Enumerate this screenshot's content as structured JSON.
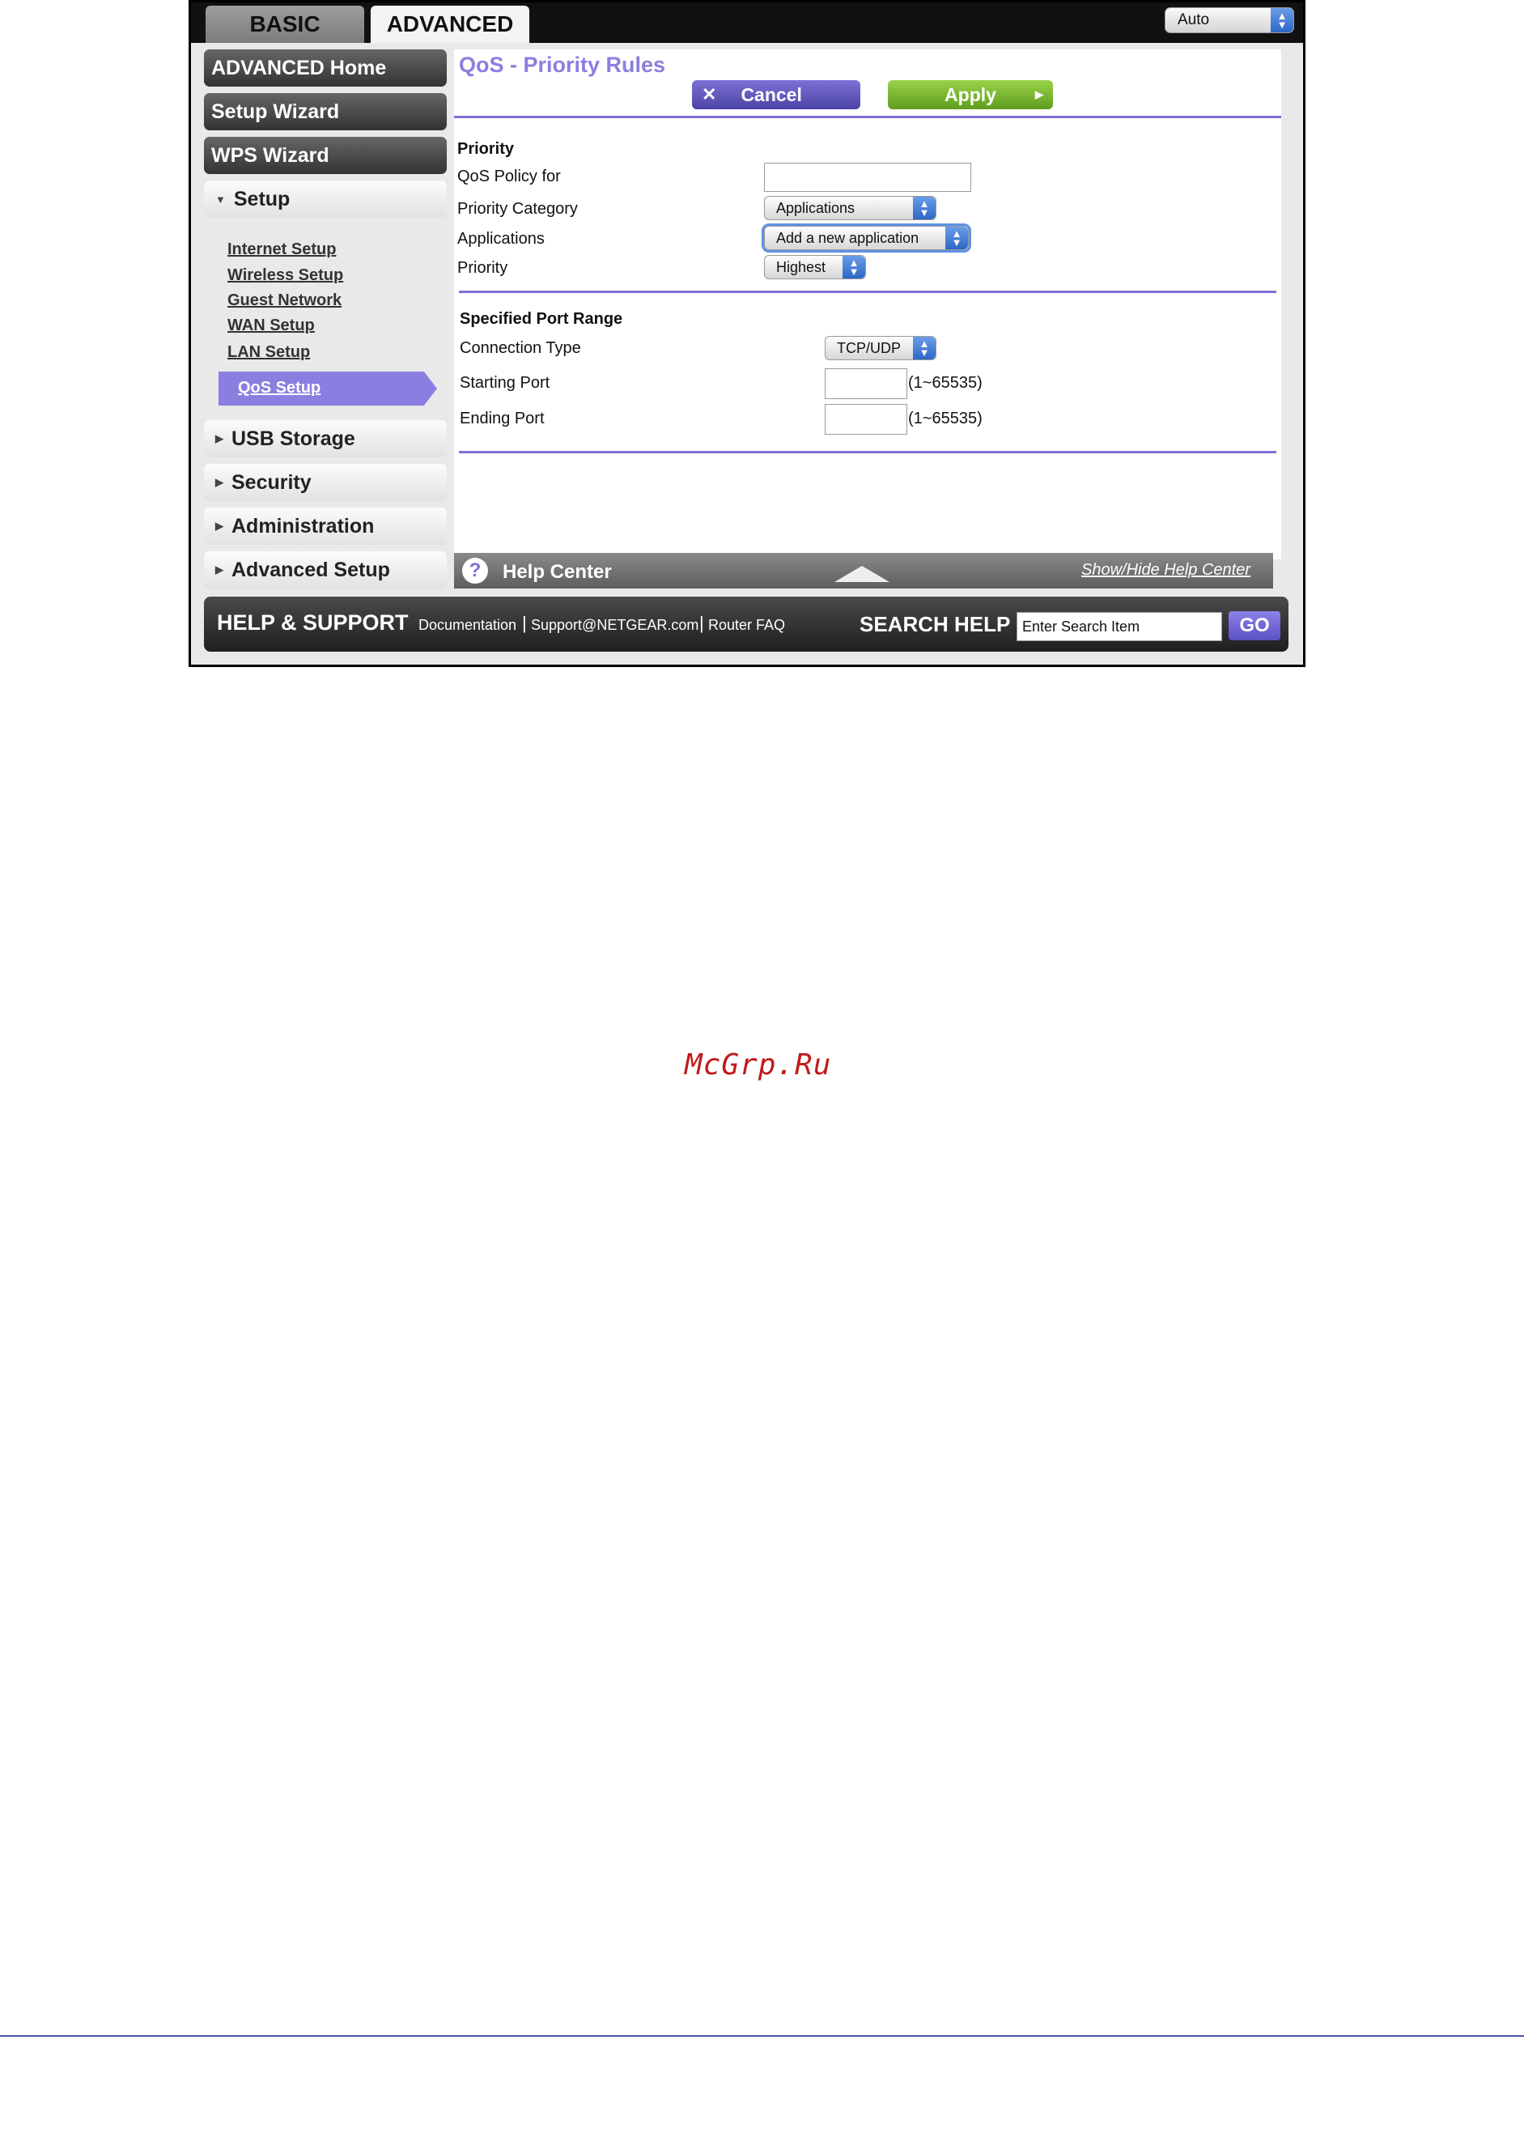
{
  "tabs": {
    "basic": "BASIC",
    "advanced": "ADVANCED"
  },
  "language_select": {
    "value": "Auto"
  },
  "sidebar": {
    "advanced_home": "ADVANCED Home",
    "setup_wizard": "Setup Wizard",
    "wps_wizard": "WPS Wizard",
    "setup": "Setup",
    "setup_items": [
      "Internet Setup",
      "Wireless Setup",
      "Guest Network",
      "WAN Setup",
      "LAN Setup",
      "QoS Setup"
    ],
    "usb_storage": "USB Storage",
    "security": "Security",
    "administration": "Administration",
    "advanced_setup": "Advanced Setup"
  },
  "page": {
    "title": "QoS - Priority Rules",
    "cancel": "Cancel",
    "apply": "Apply",
    "priority_section": "Priority",
    "qos_policy_for": "QoS Policy for",
    "qos_policy_value": "",
    "priority_category_label": "Priority Category",
    "priority_category_value": "Applications",
    "applications_label": "Applications",
    "applications_value": "Add a new application",
    "priority_label": "Priority",
    "priority_value": "Highest",
    "port_section": "Specified Port Range",
    "connection_type_label": "Connection Type",
    "connection_type_value": "TCP/UDP",
    "starting_port_label": "Starting Port",
    "ending_port_label": "Ending Port",
    "port_range_hint": "(1~65535)"
  },
  "help": {
    "title": "Help Center",
    "toggle": "Show/Hide Help Center"
  },
  "footer": {
    "title": "HELP & SUPPORT",
    "documentation": "Documentation",
    "support": "Support@NETGEAR.com",
    "router_faq": "Router FAQ",
    "search_label": "SEARCH HELP",
    "search_placeholder": "Enter Search Item",
    "go": "GO"
  },
  "watermark": "McGrp.Ru",
  "colors": {
    "accent": "#8a7fe0",
    "apply": "#7cba34",
    "dark": "#333333"
  }
}
